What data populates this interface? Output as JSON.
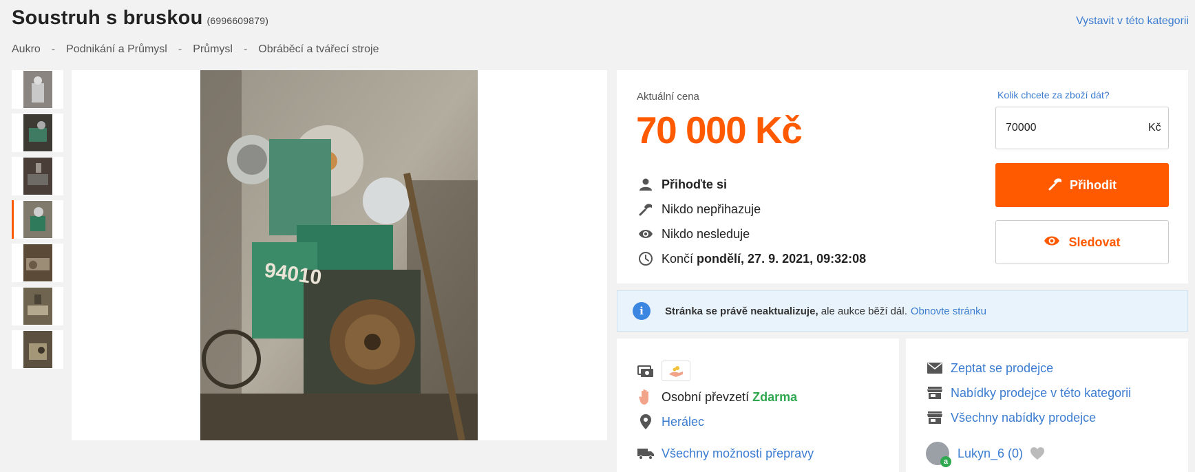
{
  "header": {
    "title": "Soustruh s bruskou",
    "item_id": "(6996609879)",
    "sell_link": "Vystavit v této kategorii"
  },
  "breadcrumb": [
    "Aukro",
    "Podnikání a Průmysl",
    "Průmysl",
    "Obráběcí a tvářecí stroje"
  ],
  "gallery": {
    "thumbnail_count": 7,
    "active_thumbnail_index": 3
  },
  "price": {
    "label": "Aktuální cena",
    "value": "70 000 Kč"
  },
  "info": {
    "bid_prompt": "Přihoďte si",
    "bidders": "Nikdo nepřihazuje",
    "watchers": "Nikdo nesleduje",
    "ends_prefix": "Končí",
    "ends_value": "pondělí, 27. 9. 2021, 09:32:08"
  },
  "bid": {
    "question": "Kolik chcete za zboží dát?",
    "input_value": "70000",
    "currency": "Kč",
    "bid_button": "Přihodit",
    "watch_button": "Sledovat"
  },
  "notice": {
    "bold": "Stránka se právě neaktualizuje,",
    "text": "ale aukce běží dál.",
    "link": "Obnovte stránku"
  },
  "delivery": {
    "pickup_label": "Osobní převzetí",
    "pickup_price": "Zdarma",
    "location": "Herálec",
    "all_options": "Všechny možnosti přepravy"
  },
  "seller": {
    "ask": "Zeptat se prodejce",
    "offers_category": "Nabídky prodejce v této kategorii",
    "offers_all": "Všechny nabídky prodejce",
    "name": "Lukyn_6 (0)"
  },
  "colors": {
    "accent": "#ff5a00",
    "link": "#3b7cd0",
    "success": "#2fa84f"
  }
}
